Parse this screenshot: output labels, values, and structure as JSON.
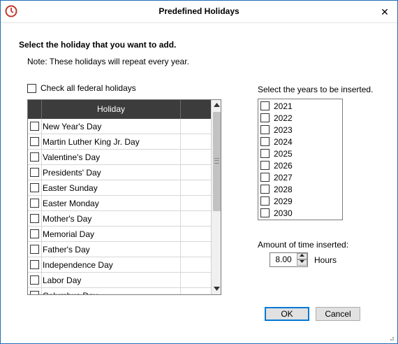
{
  "window": {
    "title": "Predefined Holidays",
    "close_glyph": "✕",
    "accent_color": "#1e6fb8"
  },
  "instruction": "Select the holiday that you want to add.",
  "note": "Note:  These holidays will repeat every year.",
  "check_all_label": "Check all federal holidays",
  "grid": {
    "column_header": "Holiday",
    "rows": [
      "New Year's Day",
      "Martin Luther King Jr. Day",
      "Valentine's Day",
      "Presidents' Day",
      "Easter Sunday",
      "Easter Monday",
      "Mother's Day",
      "Memorial Day",
      "Father's Day",
      "Independence Day",
      "Labor Day",
      "Columbus Day"
    ]
  },
  "years": {
    "label": "Select the years to be inserted.",
    "items": [
      "2021",
      "2022",
      "2023",
      "2024",
      "2025",
      "2026",
      "2027",
      "2028",
      "2029",
      "2030"
    ]
  },
  "amount": {
    "label": "Amount of time inserted:",
    "value": "8.00",
    "unit": "Hours"
  },
  "buttons": {
    "ok": "OK",
    "cancel": "Cancel"
  },
  "icons": {
    "app": "app-logo-icon",
    "close": "close-icon",
    "scroll_up": "scroll-up-arrow-icon",
    "scroll_down": "scroll-down-arrow-icon",
    "spin_up": "spin-up-icon",
    "spin_down": "spin-down-icon",
    "resize": "resize-grip-icon"
  }
}
